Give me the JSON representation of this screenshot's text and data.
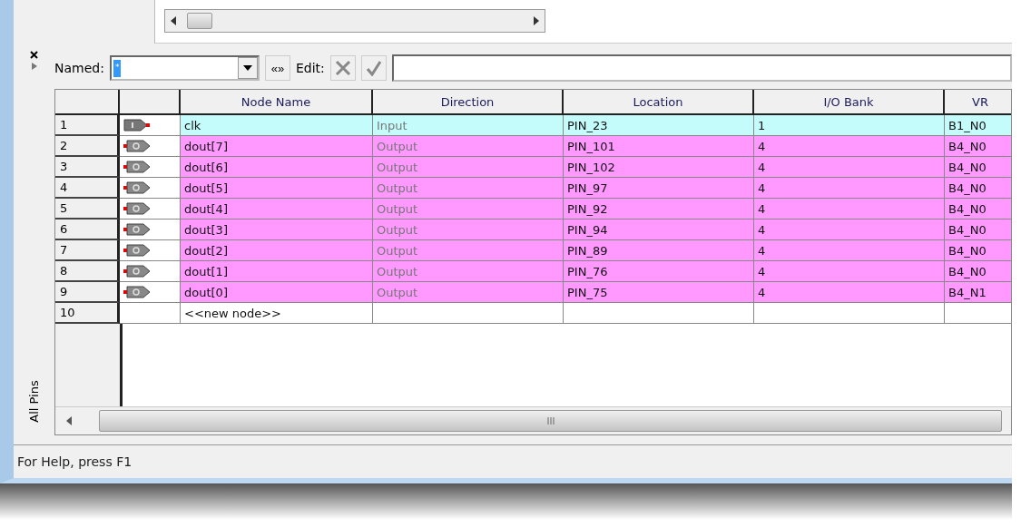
{
  "toolbar": {
    "named_label": "Named:",
    "named_value": "*",
    "expand_button": "«»",
    "edit_label": "Edit:"
  },
  "table": {
    "columns": [
      "Node Name",
      "Direction",
      "Location",
      "I/O Bank",
      "VR"
    ],
    "rows": [
      {
        "number": "1",
        "kind": "input",
        "color": "#c4fcfc",
        "node": "clk",
        "direction": "Input",
        "location": "PIN_23",
        "bank": "1",
        "vref": "B1_N0"
      },
      {
        "number": "2",
        "kind": "output",
        "color": "#ff99ff",
        "node": "dout[7]",
        "direction": "Output",
        "location": "PIN_101",
        "bank": "4",
        "vref": "B4_N0"
      },
      {
        "number": "3",
        "kind": "output",
        "color": "#ff99ff",
        "node": "dout[6]",
        "direction": "Output",
        "location": "PIN_102",
        "bank": "4",
        "vref": "B4_N0"
      },
      {
        "number": "4",
        "kind": "output",
        "color": "#ff99ff",
        "node": "dout[5]",
        "direction": "Output",
        "location": "PIN_97",
        "bank": "4",
        "vref": "B4_N0"
      },
      {
        "number": "5",
        "kind": "output",
        "color": "#ff99ff",
        "node": "dout[4]",
        "direction": "Output",
        "location": "PIN_92",
        "bank": "4",
        "vref": "B4_N0"
      },
      {
        "number": "6",
        "kind": "output",
        "color": "#ff99ff",
        "node": "dout[3]",
        "direction": "Output",
        "location": "PIN_94",
        "bank": "4",
        "vref": "B4_N0"
      },
      {
        "number": "7",
        "kind": "output",
        "color": "#ff99ff",
        "node": "dout[2]",
        "direction": "Output",
        "location": "PIN_89",
        "bank": "4",
        "vref": "B4_N0"
      },
      {
        "number": "8",
        "kind": "output",
        "color": "#ff99ff",
        "node": "dout[1]",
        "direction": "Output",
        "location": "PIN_76",
        "bank": "4",
        "vref": "B4_N0"
      },
      {
        "number": "9",
        "kind": "output",
        "color": "#ff99ff",
        "node": "dout[0]",
        "direction": "Output",
        "location": "PIN_75",
        "bank": "4",
        "vref": "B4_N1"
      },
      {
        "number": "10",
        "kind": "new",
        "node": "<<new node>>"
      }
    ]
  },
  "side_tab": "All Pins",
  "status_bar": "For Help, press F1"
}
